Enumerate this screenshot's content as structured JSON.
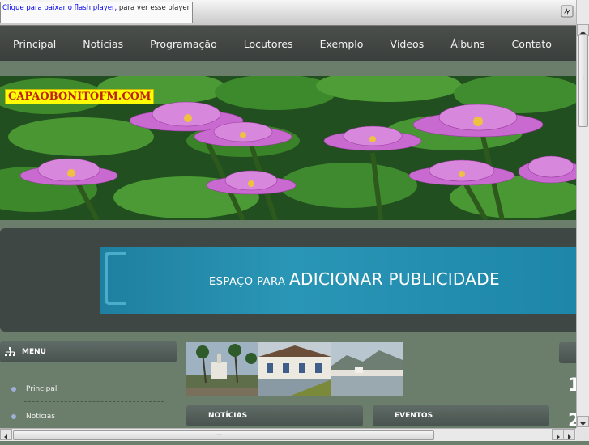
{
  "flash_notice": {
    "link_text": "Clique para baixar o flash player,",
    "rest_text": " para ver esse player"
  },
  "nav": {
    "items": [
      "Principal",
      "Notícias",
      "Programação",
      "Locutores",
      "Exemplo",
      "Vídeos",
      "Álbuns",
      "Contato"
    ]
  },
  "banner": {
    "label": "CAPAOBONITOFM.COM"
  },
  "publicity": {
    "small_text": "ESPAÇO PARA ",
    "big_text": "ADICIONAR PUBLICIDADE"
  },
  "sidebar": {
    "title": "MENU",
    "items": [
      "Principal",
      "Notícias"
    ]
  },
  "sections": {
    "noticias": "NOTÍCIAS",
    "eventos": "EVENTOS"
  },
  "right_digits": [
    "1",
    "2"
  ],
  "colors": {
    "nav_bg": "#3e4340",
    "page_bg": "#6a7e6b",
    "label_bg": "#ffff00",
    "label_text": "#c02010",
    "pub_bg": "#2a96b6"
  }
}
